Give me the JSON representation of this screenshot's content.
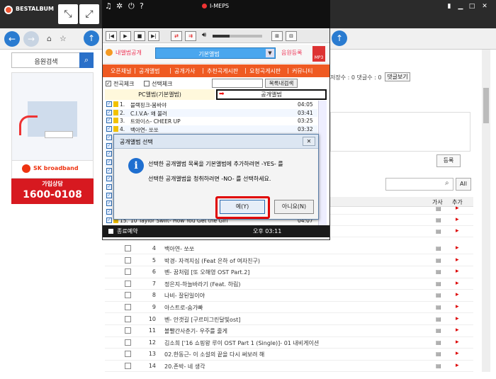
{
  "main_window": {
    "title": "BESTALBUM",
    "search_label": "음원검색",
    "search_icon": "search-icon",
    "banner": {
      "brand": "SK broadband",
      "counsel_label": "가입상담",
      "phone": "1600-0108"
    },
    "comments": {
      "stats_text": "저장수 : 0 댓글수 : 0",
      "like_label": "댓글보기"
    },
    "register_label": "등록",
    "all_label": "All",
    "table_headers": {
      "lyrics": "가사",
      "add": "추가"
    },
    "rows": [
      {
        "num": "4",
        "title": "백아연- 쏘쏘"
      },
      {
        "num": "5",
        "title": "박경- 자격지심 (Feat 은하 of 여자친구)"
      },
      {
        "num": "6",
        "title": "벤- 꿈처럼 [또 오해영 OST Part.2]"
      },
      {
        "num": "7",
        "title": "정은지-하늘바라기 (Feat. 하림)"
      },
      {
        "num": "8",
        "title": "나비- 잘된일이야"
      },
      {
        "num": "9",
        "title": "아스트로-숨가빠"
      },
      {
        "num": "10",
        "title": "벤- 안갯길 [구르미그린달빛ost]"
      },
      {
        "num": "11",
        "title": "볼빨간사춘기- 우주를 줄게"
      },
      {
        "num": "12",
        "title": "김소희 ['16 쇼핑왕 루이 OST Part 1 (Single)]- 01 내비게이션"
      },
      {
        "num": "13",
        "title": "02.한동근- 이 소설의 끝을 다시 써보려 해"
      },
      {
        "num": "14",
        "title": "20.존박- 네 생각"
      }
    ]
  },
  "meps": {
    "title": "I-MEPS",
    "my_album_label": "내앨범공개",
    "album_select": "기본앨범",
    "album_register": "음원등록",
    "mp3_label": "MP3",
    "menu": [
      "오픈채널",
      "공개앨범",
      "공개가사",
      "추천곡게시판",
      "요청곡게시판",
      "커뮤니티"
    ],
    "check_all": "전곡체크",
    "check_selected": "선택체크",
    "search_mine_btn": "목록내검색",
    "tab_pc": "PC앨범(기본앨범)",
    "tab_public": "공개앨범",
    "tracks": [
      {
        "n": "1.",
        "title": "블랙핑크-붐바야",
        "time": "04:05"
      },
      {
        "n": "2.",
        "title": "C.I.V.A- 왜 불러",
        "time": "03:41"
      },
      {
        "n": "3.",
        "title": "트와이스- CHEER UP",
        "time": "03:25"
      },
      {
        "n": "4.",
        "title": "백아연- 쏘쏘",
        "time": "03:32"
      },
      {
        "n": "15.",
        "title": "10 Taylor Swift- How You Get the Girl",
        "time": "04:07"
      }
    ],
    "status_label": "종료예약",
    "status_time": "오후   03:11"
  },
  "dialog": {
    "title": "공개앨범 선택",
    "close": "✕",
    "line1": "선택한 공개앨범 목록을 기본앨범에 추가하려면 -YES- 를",
    "line2": "선택한 공개앨범을 청취하려면 -NO- 를 선택하세요.",
    "yes_label": "예(Y)",
    "no_label": "아니요(N)",
    "highlight_color": "#e00000"
  }
}
